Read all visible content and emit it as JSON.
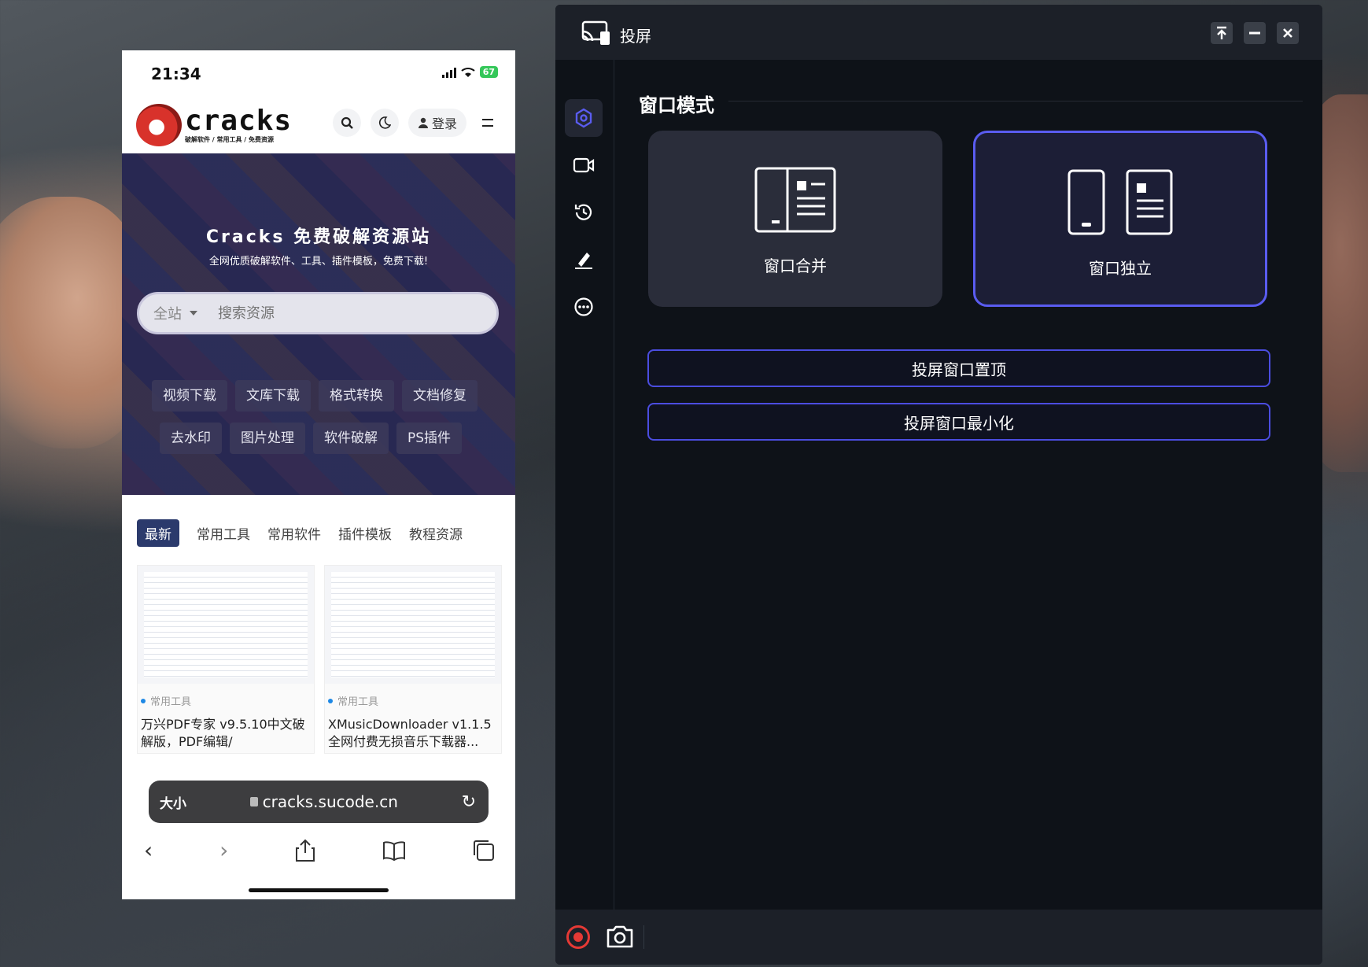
{
  "phone": {
    "status": {
      "time": "21:34",
      "battery": "67"
    },
    "site": {
      "logo_name": "cracks",
      "logo_tagline": "破解软件 / 常用工具 / 免费资源",
      "login_label": "登录"
    },
    "hero": {
      "title": "Cracks 免费破解资源站",
      "subtitle": "全网优质破解软件、工具、插件模板，免费下载!",
      "search_scope": "全站",
      "search_placeholder": "搜索资源",
      "quick_tags_row1": [
        "视频下载",
        "文库下载",
        "格式转换",
        "文档修复"
      ],
      "quick_tags_row2": [
        "去水印",
        "图片处理",
        "软件破解",
        "PS插件"
      ]
    },
    "tabs": [
      "最新",
      "常用工具",
      "常用软件",
      "插件模板",
      "教程资源"
    ],
    "cards": [
      {
        "category": "常用工具",
        "title": "万兴PDF专家 v9.5.10中文破解版，PDF编辑/"
      },
      {
        "category": "常用工具",
        "title": "XMusicDownloader v1.1.5 全网付费无损音乐下载器..."
      }
    ],
    "browser": {
      "text_size": "大小",
      "url": "cracks.sucode.cn"
    }
  },
  "cast": {
    "title": "投屏",
    "section_title": "窗口模式",
    "modes": [
      {
        "label": "窗口合并",
        "selected": false
      },
      {
        "label": "窗口独立",
        "selected": true
      }
    ],
    "actions": [
      "投屏窗口置顶",
      "投屏窗口最小化"
    ],
    "sidebar_icons": [
      "settings-icon",
      "video-icon",
      "history-icon",
      "sign-icon",
      "more-icon"
    ],
    "accent_color": "#5a5cf0",
    "record_color": "#e53935"
  }
}
